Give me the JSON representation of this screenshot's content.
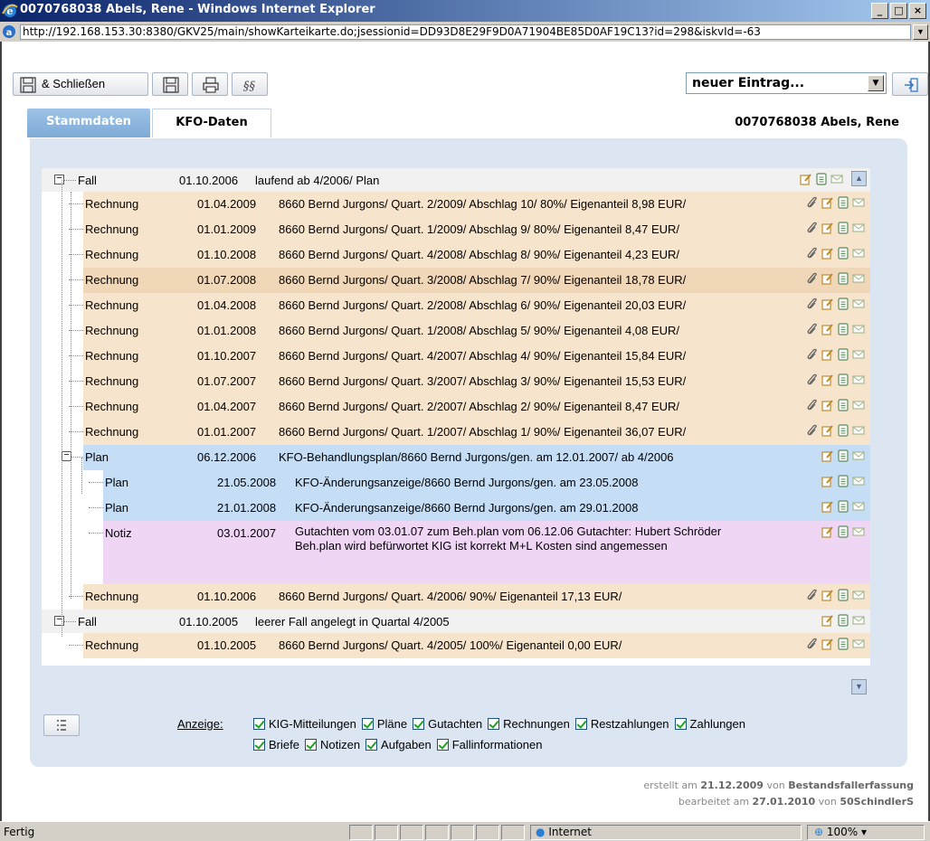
{
  "window": {
    "title": "0070768038 Abels, Rene - Windows Internet Explorer",
    "url": "http://192.168.153.30:8380/GKV25/main/showKarteikarte.do;jsessionid=DD93D8E29F9D0A71904BE85D0AF19C13?id=298&iskvId=-63"
  },
  "toolbar": {
    "save_close_label": "& Schließen",
    "new_entry_select": "neuer Eintrag..."
  },
  "tabs": [
    "Stammdaten",
    "KFO-Daten"
  ],
  "active_tab": "KFO-Daten",
  "patient": "0070768038 Abels, Rene",
  "rows": [
    {
      "type": "Fall",
      "date": "01.10.2006",
      "desc": "laufend ab 4/2006/ Plan",
      "attach": false
    },
    {
      "type": "Rechnung",
      "date": "01.04.2009",
      "desc": "8660 Bernd Jurgons/ Quart. 2/2009/ Abschlag 10/ 80%/ Eigenanteil 8,98 EUR/",
      "attach": true
    },
    {
      "type": "Rechnung",
      "date": "01.01.2009",
      "desc": "8660 Bernd Jurgons/ Quart. 1/2009/ Abschlag 9/ 80%/ Eigenanteil 8,47 EUR/",
      "attach": true
    },
    {
      "type": "Rechnung",
      "date": "01.10.2008",
      "desc": "8660 Bernd Jurgons/ Quart. 4/2008/ Abschlag 8/ 90%/ Eigenanteil 4,23 EUR/",
      "attach": true
    },
    {
      "type": "Rechnung",
      "date": "01.07.2008",
      "desc": "8660 Bernd Jurgons/ Quart. 3/2008/ Abschlag 7/ 90%/ Eigenanteil 18,78 EUR/",
      "attach": true
    },
    {
      "type": "Rechnung",
      "date": "01.04.2008",
      "desc": "8660 Bernd Jurgons/ Quart. 2/2008/ Abschlag 6/ 90%/ Eigenanteil 20,03 EUR/",
      "attach": true
    },
    {
      "type": "Rechnung",
      "date": "01.01.2008",
      "desc": "8660 Bernd Jurgons/ Quart. 1/2008/ Abschlag 5/ 90%/ Eigenanteil 4,08 EUR/",
      "attach": true
    },
    {
      "type": "Rechnung",
      "date": "01.10.2007",
      "desc": "8660 Bernd Jurgons/ Quart. 4/2007/ Abschlag 4/ 90%/ Eigenanteil 15,84 EUR/",
      "attach": true
    },
    {
      "type": "Rechnung",
      "date": "01.07.2007",
      "desc": "8660 Bernd Jurgons/ Quart. 3/2007/ Abschlag 3/ 90%/ Eigenanteil 15,53 EUR/",
      "attach": true
    },
    {
      "type": "Rechnung",
      "date": "01.04.2007",
      "desc": "8660 Bernd Jurgons/ Quart. 2/2007/ Abschlag 2/ 90%/ Eigenanteil 8,47 EUR/",
      "attach": true
    },
    {
      "type": "Rechnung",
      "date": "01.01.2007",
      "desc": "8660 Bernd Jurgons/ Quart. 1/2007/ Abschlag 1/ 90%/ Eigenanteil 36,07 EUR/",
      "attach": true
    },
    {
      "type": "Plan",
      "date": "06.12.2006",
      "desc": "KFO-Behandlungsplan/8660 Bernd Jurgons/gen. am 12.01.2007/ ab 4/2006",
      "attach": false
    },
    {
      "type": "Plan",
      "date": "21.05.2008",
      "desc": "KFO-Änderungsanzeige/8660 Bernd Jurgons/gen. am 23.05.2008",
      "attach": false
    },
    {
      "type": "Plan",
      "date": "21.01.2008",
      "desc": "KFO-Änderungsanzeige/8660 Bernd Jurgons/gen. am 29.01.2008",
      "attach": false
    },
    {
      "type": "Notiz",
      "date": "03.01.2007",
      "desc": "Gutachten vom 03.01.07 zum Beh.plan vom 06.12.06 Gutachter: Hubert Schröder Beh.plan wird befürwortet KIG ist korrekt M+L Kosten sind angemessen",
      "attach": false
    },
    {
      "type": "Rechnung",
      "date": "01.10.2006",
      "desc": "8660 Bernd Jurgons/ Quart. 4/2006/ 90%/ Eigenanteil 17,13 EUR/",
      "attach": true
    },
    {
      "type": "Fall",
      "date": "01.10.2005",
      "desc": "leerer Fall angelegt in Quartal 4/2005",
      "attach": false
    },
    {
      "type": "Rechnung",
      "date": "01.10.2005",
      "desc": "8660 Bernd Jurgons/ Quart. 4/2005/ 100%/ Eigenanteil 0,00 EUR/",
      "attach": true
    }
  ],
  "anzeige": {
    "label": "Anzeige:",
    "line1": [
      "KIG-Mitteilungen",
      "Pläne",
      "Gutachten",
      "Rechnungen",
      "Restzahlungen",
      "Zahlungen"
    ],
    "line2": [
      "Briefe",
      "Notizen",
      "Aufgaben",
      "Fallinformationen"
    ]
  },
  "footer": {
    "created_prefix": "erstellt am",
    "created_date": "21.12.2009",
    "created_by_prefix": "von",
    "created_by": "Bestandsfallerfassung",
    "edited_prefix": "bearbeitet am",
    "edited_date": "27.01.2010",
    "edited_by_prefix": "von",
    "edited_by": "50SchindlerS"
  },
  "statusbar": {
    "status": "Fertig",
    "zone": "Internet",
    "zoom": "100%"
  },
  "colors": {
    "fall_row": "#f1f1f1",
    "rechnung_row": "#f6e5cc",
    "plan_row": "#c5def5",
    "notiz_row": "#f0d6f5",
    "panel": "#dbe6f2"
  }
}
